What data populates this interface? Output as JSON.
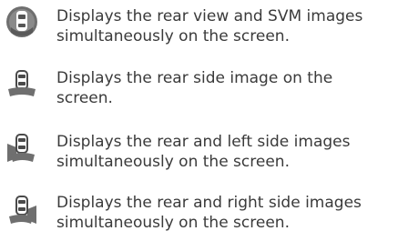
{
  "modes": [
    {
      "icon": "rear-svm-view-icon",
      "line1": "Displays the rear view and SVM images",
      "line2": "simultaneously on the screen."
    },
    {
      "icon": "rear-side-view-icon",
      "line1": "Displays the rear side image on the",
      "line2": "screen."
    },
    {
      "icon": "rear-left-side-view-icon",
      "line1": "Displays the rear and left side images",
      "line2": "simultaneously on the screen."
    },
    {
      "icon": "rear-right-side-view-icon",
      "line1": "Displays the rear and right side images",
      "line2": "simultaneously on the screen."
    }
  ],
  "colors": {
    "icon_fill": "#6f6f6f",
    "icon_dark": "#4a4a4a",
    "text": "#3a3a3a"
  }
}
